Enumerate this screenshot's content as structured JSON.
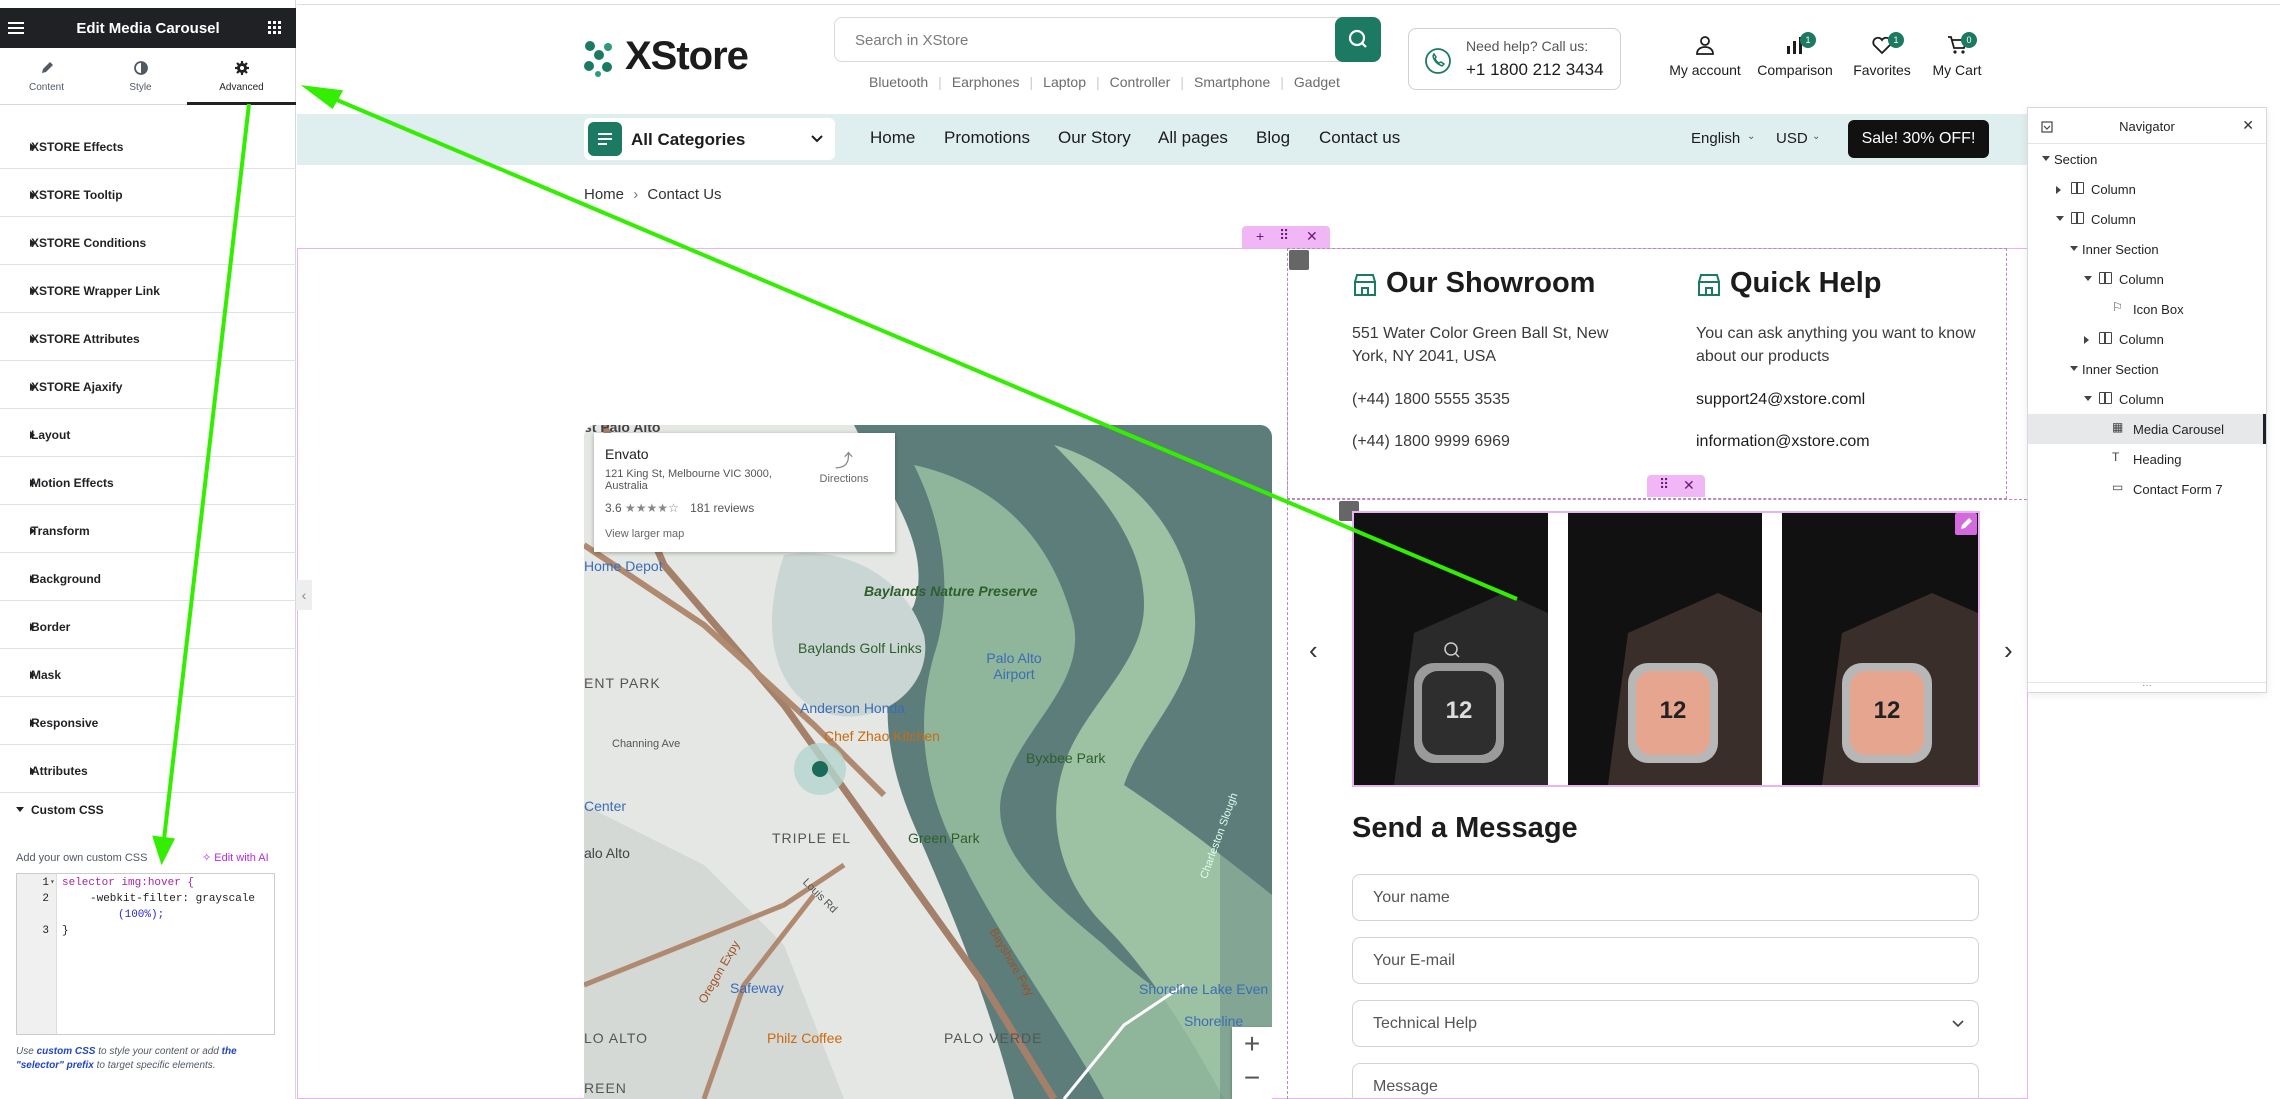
{
  "panel": {
    "title": "Edit Media Carousel",
    "tabs": [
      {
        "label": "Content",
        "icon": "pencil-icon"
      },
      {
        "label": "Style",
        "icon": "contrast-icon"
      },
      {
        "label": "Advanced",
        "icon": "gear-icon",
        "active": true
      }
    ],
    "sections": [
      "XSTORE Effects",
      "XSTORE Tooltip",
      "XSTORE Conditions",
      "XSTORE Wrapper Link",
      "XSTORE Attributes",
      "XSTORE Ajaxify",
      "Layout",
      "Motion Effects",
      "Transform",
      "Background",
      "Border",
      "Mask",
      "Responsive",
      "Attributes"
    ],
    "custom_css": {
      "heading": "Custom CSS",
      "label": "Add your own custom CSS",
      "ai_link": "Edit with AI",
      "line_numbers": [
        "1",
        "2",
        "3"
      ],
      "code_line1": "selector img:hover {",
      "code_line2a": "-webkit-filter: grayscale",
      "code_line2b": "(100%);",
      "code_line3": "}",
      "help_pre": "Use ",
      "help_link1": "custom CSS",
      "help_mid": " to style your content or add ",
      "help_link2": "the \"selector\" prefix",
      "help_post": " to target specific elements."
    }
  },
  "site": {
    "logo": "XStore",
    "search": {
      "placeholder": "Search in XStore"
    },
    "quick_links": [
      "Bluetooth",
      "Earphones",
      "Laptop",
      "Controller",
      "Smartphone",
      "Gadget"
    ],
    "help": {
      "line1": "Need help? Call us:",
      "phone": "+1 1800 212 3434"
    },
    "header_icons": [
      {
        "label": "My account",
        "icon": "user-icon"
      },
      {
        "label": "Comparison",
        "icon": "bar-chart-icon",
        "badge": "1"
      },
      {
        "label": "Favorites",
        "icon": "heart-icon",
        "badge": "1"
      },
      {
        "label": "My Cart",
        "icon": "cart-icon",
        "badge": "0"
      }
    ],
    "all_categories": "All Categories",
    "nav": [
      "Home",
      "Promotions",
      "Our Story",
      "All pages",
      "Blog",
      "Contact us"
    ],
    "language": "English",
    "currency": "USD",
    "sale": "Sale! 30% OFF!",
    "breadcrumb": [
      "Home",
      "Contact Us"
    ]
  },
  "map": {
    "place": "Envato",
    "address": "121 King St, Melbourne VIC 3000, Australia",
    "rating": "3.6",
    "reviews": "181 reviews",
    "directions": "Directions",
    "larger": "View larger map",
    "labels": [
      "st Palo Alto",
      "Home Depot",
      "ENT PARK",
      "Baylands Nature Preserve",
      "Baylands Golf Links",
      "Palo Alto Airport",
      "Anderson Honda",
      "Chef Zhao Kitchen",
      "Byxbee Park",
      "Channing Ave",
      "Center",
      "Green Park",
      "TRIPLE EL",
      "alo Alto",
      "Louis Rd",
      "Charleston Slough",
      "Oregon Expy",
      "Bayshore Fwy",
      "Safeway",
      "Shoreline Lake Even",
      "Philz Coffee",
      "PALO VERDE",
      "LO ALTO",
      "Shoreline",
      "REEN"
    ]
  },
  "showroom": {
    "title": "Our Showroom",
    "address": "551 Water Color Green Ball St, New York, NY 2041, USA",
    "phone1": "(+44) 1800 5555 3535",
    "phone2": "(+44) 1800 9999 6969"
  },
  "quickhelp": {
    "title": "Quick Help",
    "text": "You can ask anything you want to know about our products",
    "email1": "support24@xstore.coml",
    "email2": "information@xstore.com"
  },
  "form": {
    "title": "Send a Message",
    "name": "Your name",
    "email": "Your E-mail",
    "topic": "Technical Help",
    "message": "Message"
  },
  "navigator": {
    "title": "Navigator",
    "items": [
      {
        "label": "Section",
        "depth": 0,
        "arrow": "down",
        "icon": "none"
      },
      {
        "label": "Column",
        "depth": 1,
        "arrow": "right",
        "icon": "column"
      },
      {
        "label": "Column",
        "depth": 1,
        "arrow": "down",
        "icon": "column"
      },
      {
        "label": "Inner Section",
        "depth": 2,
        "arrow": "down",
        "icon": "none"
      },
      {
        "label": "Column",
        "depth": 3,
        "arrow": "down",
        "icon": "column"
      },
      {
        "label": "Icon Box",
        "depth": 4,
        "arrow": "none",
        "icon": "flag"
      },
      {
        "label": "Column",
        "depth": 3,
        "arrow": "right",
        "icon": "column"
      },
      {
        "label": "Inner Section",
        "depth": 2,
        "arrow": "down",
        "icon": "none"
      },
      {
        "label": "Column",
        "depth": 3,
        "arrow": "down",
        "icon": "column"
      },
      {
        "label": "Media Carousel",
        "depth": 4,
        "arrow": "none",
        "icon": "grid",
        "selected": true
      },
      {
        "label": "Heading",
        "depth": 4,
        "arrow": "none",
        "icon": "heading"
      },
      {
        "label": "Contact Form 7",
        "depth": 4,
        "arrow": "none",
        "icon": "form"
      }
    ]
  },
  "colors": {
    "accent": "#1c7a62",
    "annotation": "#33ee00",
    "elementor_pink": "#e8b3ef"
  }
}
